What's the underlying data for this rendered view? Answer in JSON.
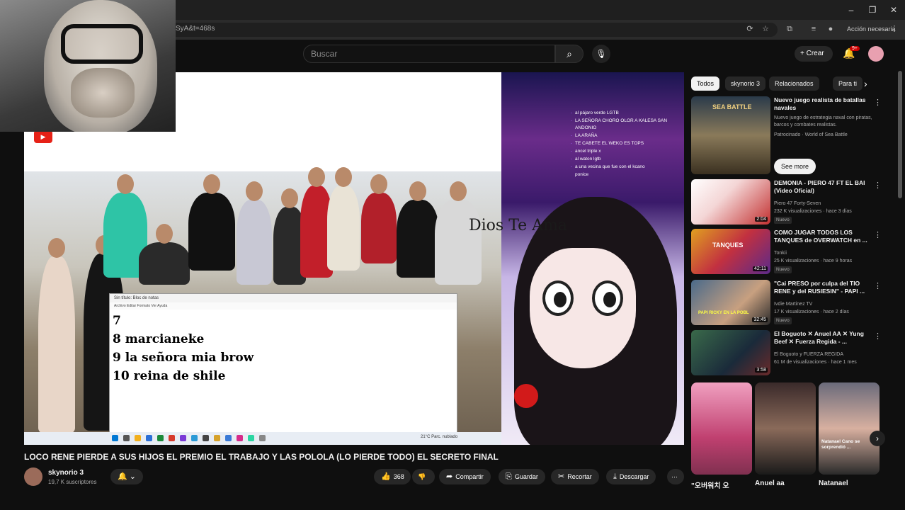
{
  "browser": {
    "url_fragment": "SyA&t=468s",
    "profile_label": "Acción necesaria"
  },
  "search": {
    "placeholder": "Buscar"
  },
  "topbar": {
    "create_label": "Crear",
    "notif_count": "9+"
  },
  "video": {
    "notepad_title": "Sin título: Bloc de notas",
    "notepad_menu": "Archivo  Editar  Formato  Ver  Ayuda",
    "notepad_lines": [
      "7",
      "8 marcianeke",
      "9 la señora mia brow",
      "10 reina de shile"
    ],
    "tray_text": "21°C Parc. nublado",
    "overlay_text": "Dios Te Ama",
    "chat": [
      {
        "user": "-",
        "msg": "al pájaro verde LGTB"
      },
      {
        "user": "-",
        "msg": "LA SEÑORA CHORO OLOR A KALESA SAN"
      },
      {
        "user": "",
        "msg": "ANDONIO"
      },
      {
        "user": "-",
        "msg": "LA ARAÑA"
      },
      {
        "user": "-",
        "msg": "TE CABETE EL WEKO ES TOPS"
      },
      {
        "user": "-",
        "msg": "ancel triple x"
      },
      {
        "user": "-",
        "msg": "al waton lgtb"
      },
      {
        "user": "-",
        "msg": "a una vecina que fue con el kcano"
      },
      {
        "user": "",
        "msg": "ponice"
      }
    ]
  },
  "title": "LOCO RENE PIERDE A SUS HIJOS EL PREMIO EL TRABAJO Y LAS POLOLA (LO PIERDE TODO) EL SECRETO FINAL",
  "channel": {
    "name": "skynorio 3",
    "subs": "19,7 K suscriptores"
  },
  "actions": {
    "likes": "368",
    "share": "Compartir",
    "save": "Guardar",
    "clip": "Recortar",
    "download": "Descargar"
  },
  "chips": [
    "Todos",
    "skynorio 3",
    "Relacionados",
    "Para ti"
  ],
  "recs": [
    {
      "title": "Nuevo juego realista de batallas navales",
      "meta1": "Nuevo juego de estrategia naval con piratas, barcos y combates realistas.",
      "meta2": "Patrocinado · World of Sea Battle",
      "button": "See more",
      "thumb_text": "SEA BATTLE",
      "duration": ""
    },
    {
      "title": "DEMONIA - PIERO 47 FT EL BAI (Video Oficial)",
      "meta1": "Piero 47 Forty-Seven",
      "meta2": "232 K visualizaciones · hace 3 días",
      "badge": "Nuevo",
      "duration": "2:04"
    },
    {
      "title": "COMO JUGAR TODOS LOS TANQUES de OVERWATCH en ...",
      "meta1": "Tonkii",
      "meta2": "25 K visualizaciones · hace 9 horas",
      "badge": "Nuevo",
      "thumb_text": "TANQUES",
      "duration": "42:11"
    },
    {
      "title": "\"Cai PRESO por culpa del TIO RENE y del RUSIESIN\" - PAPI ...",
      "meta1": "Ivdie Martinez TV",
      "meta2": "17 K visualizaciones · hace 2 días",
      "badge": "Nuevo",
      "thumb_text": "PAPI RICKY EN LA POBL",
      "duration": "32:45"
    },
    {
      "title": "El Boguoto ✕ Anuel AA ✕ Yung Beef ✕ Fuerza Regida - ...",
      "meta1": "El Boguoto y FUERZA REGIDA",
      "meta2": "61 M de visualizaciones · hace 1 mes",
      "duration": "3:58"
    }
  ],
  "shorts": [
    {
      "label": "\"오버워치 오"
    },
    {
      "label": "Anuel aa"
    },
    {
      "label": "Natanael",
      "overlay": "Natanael Cano se sorprendió ..."
    }
  ]
}
